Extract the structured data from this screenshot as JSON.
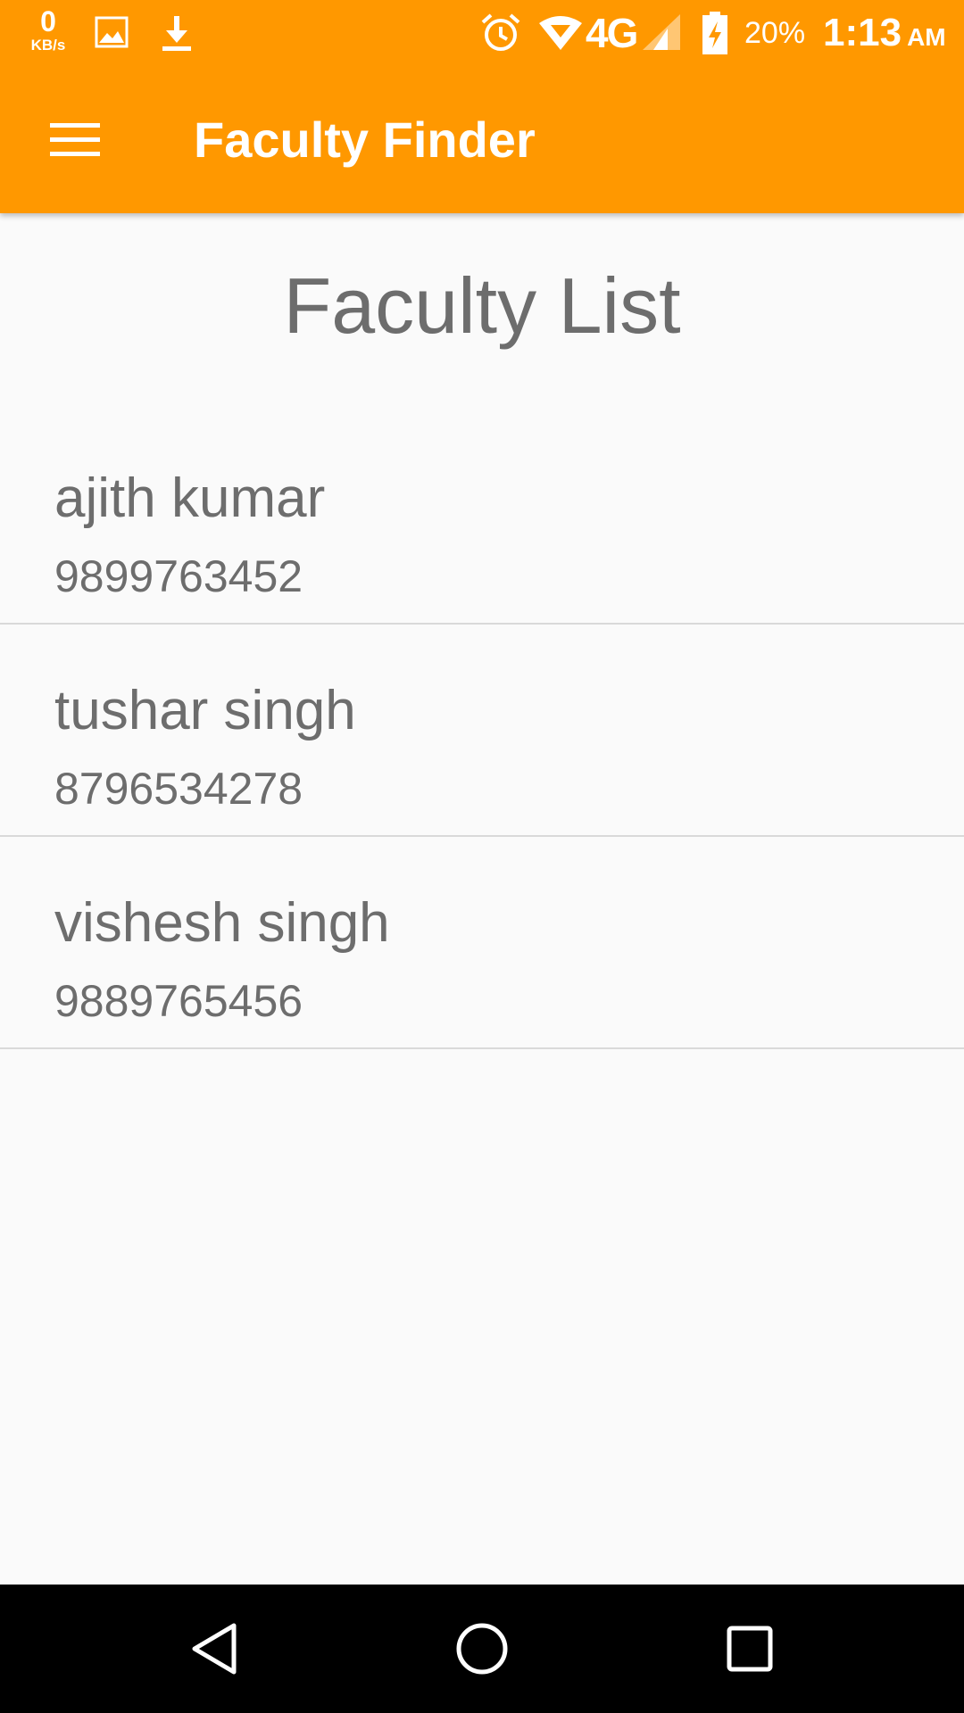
{
  "status_bar": {
    "net_speed_value": "0",
    "net_speed_unit": "KB/s",
    "icons": [
      "net-speed",
      "image-icon",
      "download-icon",
      "alarm-icon",
      "wifi-icon",
      "signal-icon",
      "battery-charging-icon"
    ],
    "network_type": "4G",
    "battery_percent": "20%",
    "time": "1:13",
    "ampm": "AM"
  },
  "toolbar": {
    "title": "Faculty Finder",
    "menu_icon": "hamburger-menu-icon"
  },
  "main": {
    "heading": "Faculty List",
    "faculty": [
      {
        "name": "ajith kumar",
        "phone": "9899763452"
      },
      {
        "name": "tushar singh",
        "phone": "8796534278"
      },
      {
        "name": "vishesh singh",
        "phone": "9889765456"
      }
    ]
  },
  "nav_bar": {
    "buttons": [
      "back-icon",
      "home-icon",
      "recents-icon"
    ]
  },
  "colors": {
    "primary": "#ff9800",
    "text": "#6d6d6d",
    "background": "#fafafa",
    "divider": "#d9d9d9"
  }
}
